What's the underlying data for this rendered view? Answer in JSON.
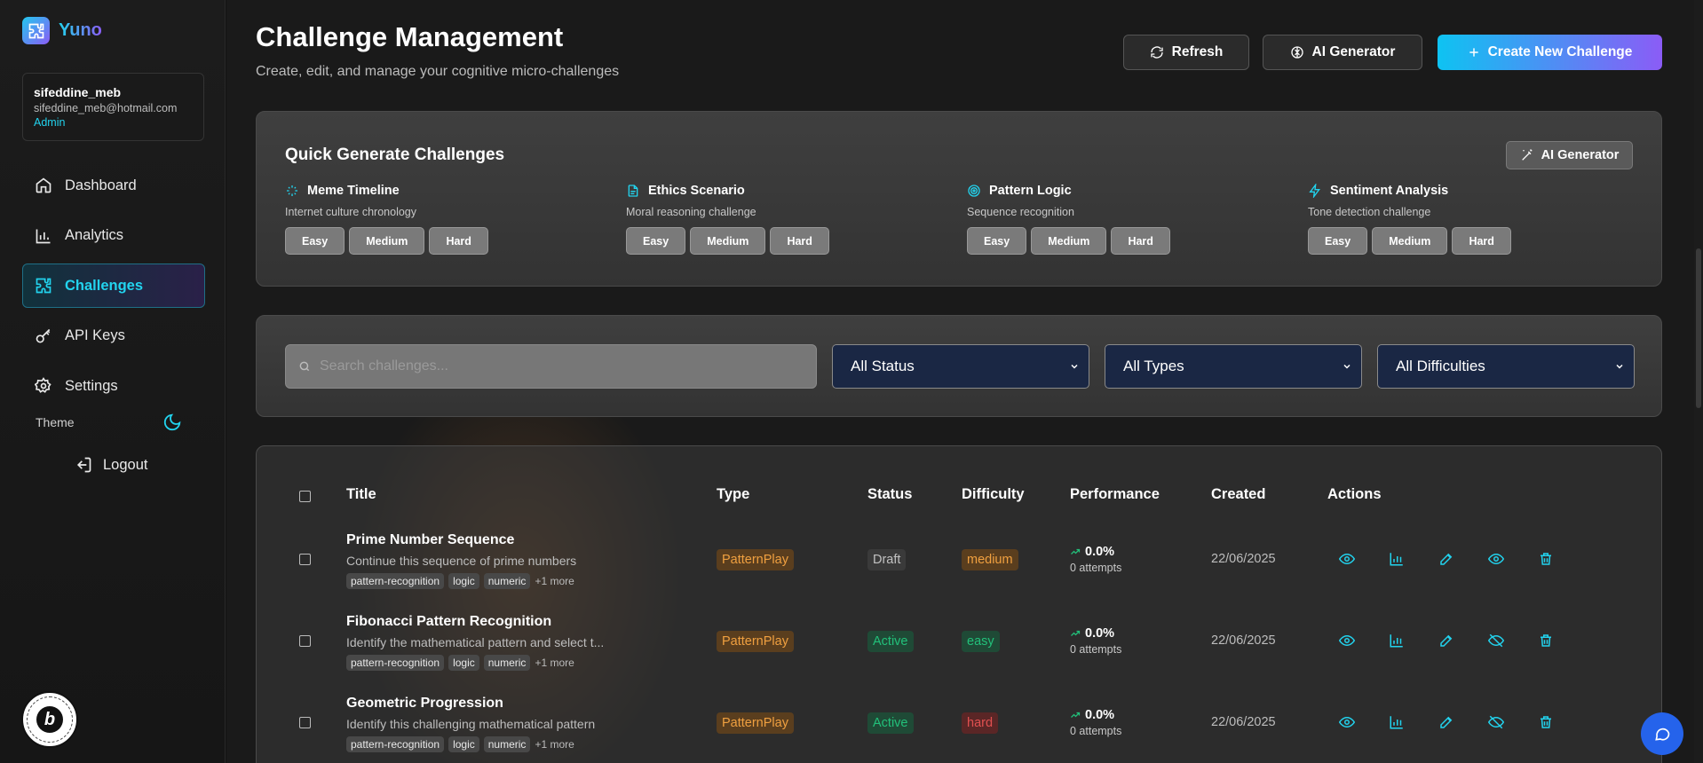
{
  "app": {
    "name": "Yuno"
  },
  "user": {
    "name": "sifeddine_meb",
    "email": "sifeddine_meb@hotmail.com",
    "role": "Admin"
  },
  "nav": {
    "items": [
      {
        "label": "Dashboard",
        "icon": "home-icon"
      },
      {
        "label": "Analytics",
        "icon": "bar-chart-icon"
      },
      {
        "label": "Challenges",
        "icon": "puzzle-icon",
        "active": true
      },
      {
        "label": "API Keys",
        "icon": "key-icon"
      },
      {
        "label": "Settings",
        "icon": "gear-icon"
      }
    ],
    "theme_label": "Theme",
    "logout_label": "Logout"
  },
  "header": {
    "title": "Challenge Management",
    "subtitle": "Create, edit, and manage your cognitive micro-challenges",
    "refresh_label": "Refresh",
    "ai_label": "AI Generator",
    "create_label": "Create New Challenge"
  },
  "quick_generate": {
    "title": "Quick Generate Challenges",
    "ai_label": "AI Generator",
    "categories": [
      {
        "name": "Meme Timeline",
        "desc": "Internet culture chronology",
        "icon": "sparkles-icon"
      },
      {
        "name": "Ethics Scenario",
        "desc": "Moral reasoning challenge",
        "icon": "document-icon"
      },
      {
        "name": "Pattern Logic",
        "desc": "Sequence recognition",
        "icon": "target-icon"
      },
      {
        "name": "Sentiment Analysis",
        "desc": "Tone detection challenge",
        "icon": "lightning-icon"
      }
    ],
    "levels": [
      "Easy",
      "Medium",
      "Hard"
    ]
  },
  "filters": {
    "search_placeholder": "Search challenges...",
    "status": "All Status",
    "type": "All Types",
    "difficulty": "All Difficulties"
  },
  "table": {
    "headers": [
      "Title",
      "Type",
      "Status",
      "Difficulty",
      "Performance",
      "Created",
      "Actions"
    ],
    "rows": [
      {
        "title": "Prime Number Sequence",
        "desc": "Continue this sequence of prime numbers",
        "tags": [
          "pattern-recognition",
          "logic",
          "numeric"
        ],
        "more": "+1 more",
        "type": "PatternPlay",
        "status": "Draft",
        "difficulty": "medium",
        "perf": "0.0%",
        "attempts": "0 attempts",
        "created": "22/06/2025"
      },
      {
        "title": "Fibonacci Pattern Recognition",
        "desc": "Identify the mathematical pattern and select t...",
        "tags": [
          "pattern-recognition",
          "logic",
          "numeric"
        ],
        "more": "+1 more",
        "type": "PatternPlay",
        "status": "Active",
        "difficulty": "easy",
        "perf": "0.0%",
        "attempts": "0 attempts",
        "created": "22/06/2025"
      },
      {
        "title": "Geometric Progression",
        "desc": "Identify this challenging mathematical pattern",
        "tags": [
          "pattern-recognition",
          "logic",
          "numeric"
        ],
        "more": "+1 more",
        "type": "PatternPlay",
        "status": "Active",
        "difficulty": "hard",
        "perf": "0.0%",
        "attempts": "0 attempts",
        "created": "22/06/2025"
      }
    ]
  },
  "colors": {
    "accent": "#22d3ee",
    "brand_gradient_start": "#0ec3f2",
    "brand_gradient_end": "#8b5cf6"
  }
}
